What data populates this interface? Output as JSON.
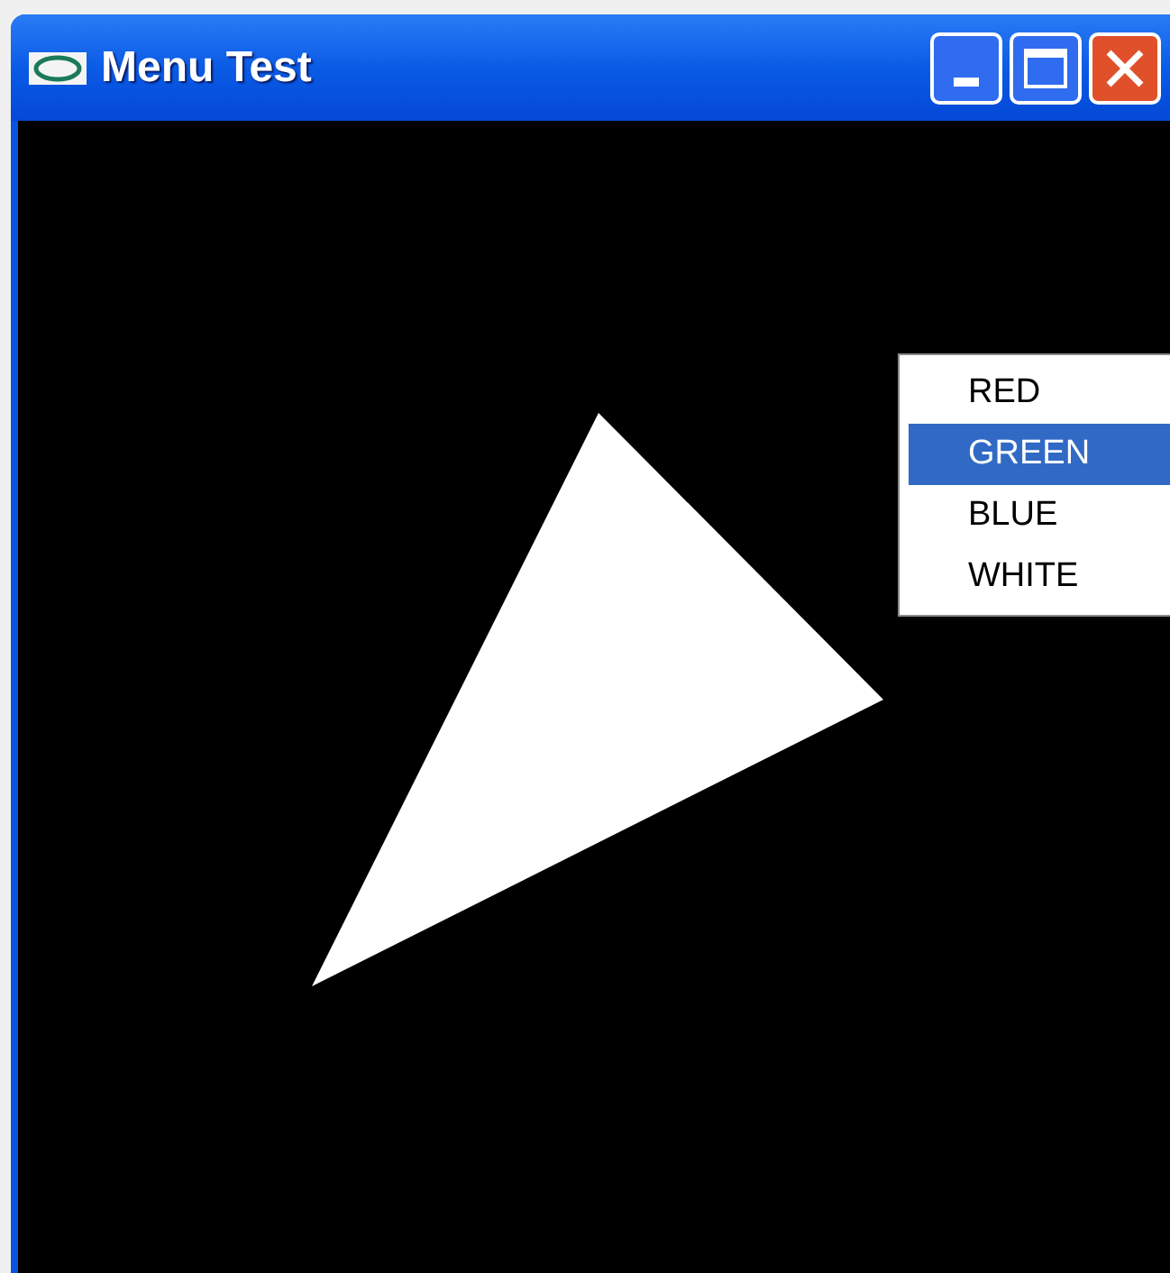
{
  "window": {
    "title": "Menu Test"
  },
  "menu": {
    "items": [
      {
        "label": "RED",
        "selected": false
      },
      {
        "label": "GREEN",
        "selected": true
      },
      {
        "label": "BLUE",
        "selected": false
      },
      {
        "label": "WHITE",
        "selected": false
      }
    ]
  }
}
